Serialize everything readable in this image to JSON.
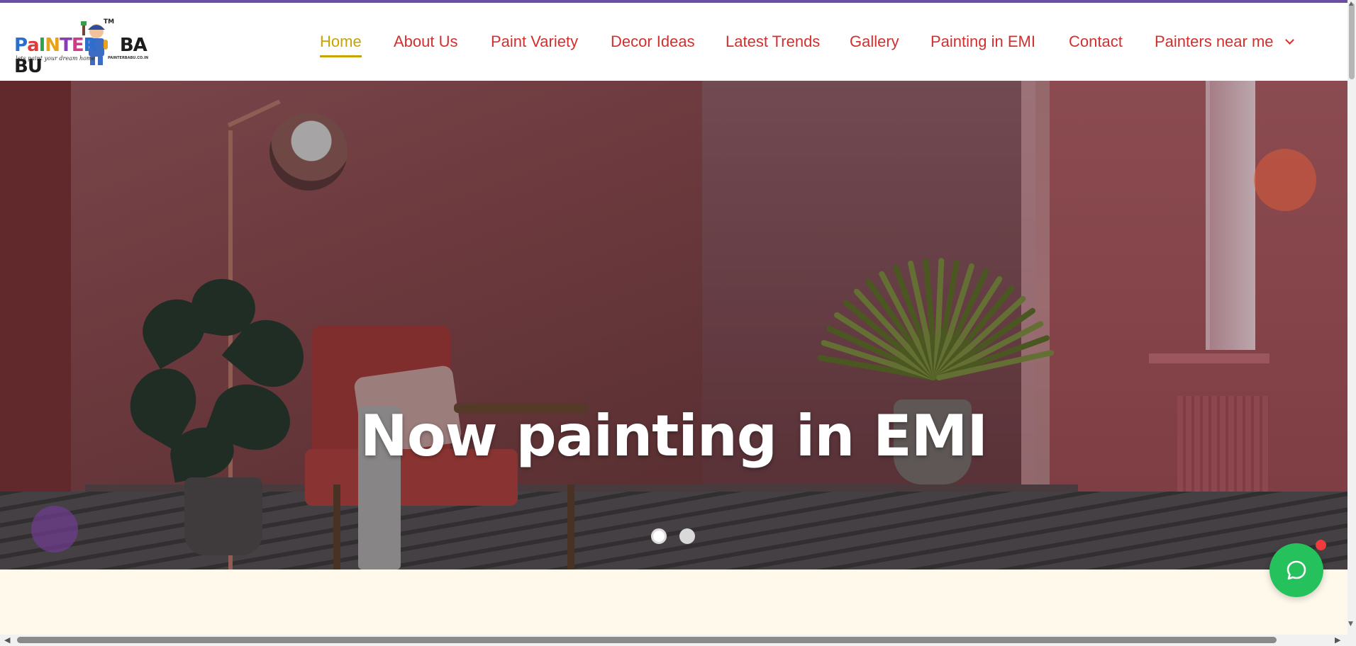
{
  "brand": {
    "logo_letters": [
      "P",
      "a",
      "I",
      "N",
      "T",
      "E",
      "R",
      " ",
      "B",
      "A",
      "B",
      "U"
    ],
    "logo_colors": [
      "#2a6fcf",
      "#e23b3b",
      "#2fa24a",
      "#e8a21c",
      "#8a3cb8",
      "#d13a8a",
      "#2a6fcf",
      "#000000",
      "#1c1c1c",
      "#1c1c1c",
      "#1c1c1c",
      "#1c1c1c"
    ],
    "tagline": "lets paint your dream home",
    "url": "PAINTERBABU.CO.IN",
    "tm": "TM"
  },
  "nav": {
    "items": [
      {
        "label": "Home",
        "active": true
      },
      {
        "label": "About Us"
      },
      {
        "label": "Paint Variety"
      },
      {
        "label": "Decor Ideas"
      },
      {
        "label": "Latest Trends"
      },
      {
        "label": "Gallery"
      },
      {
        "label": "Painting in EMI"
      },
      {
        "label": "Contact"
      },
      {
        "label": "Painters near me",
        "dropdown": true
      }
    ],
    "color": "#d32f2f",
    "active_color": "#c9a300"
  },
  "hero": {
    "title": "Now painting in EMI",
    "slides": 2,
    "active_slide": 1
  },
  "chat": {
    "icon": "chat-bubble-icon",
    "color": "#25c15d",
    "badge_color": "#ef3b3b"
  },
  "scrollbars": {
    "up_arrow": "▲",
    "down_arrow": "▼",
    "left_arrow": "◀",
    "right_arrow": "▶"
  }
}
